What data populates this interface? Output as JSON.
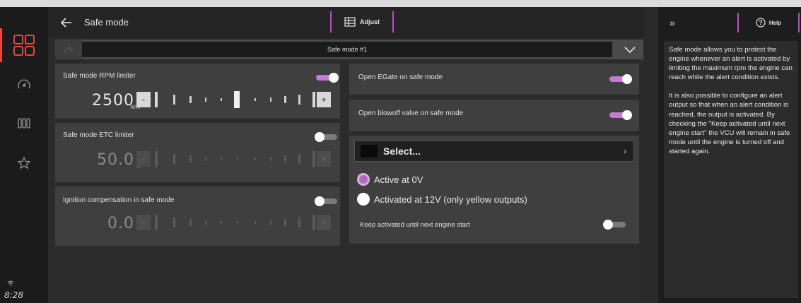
{
  "nav": {
    "time": "8:28",
    "items": [
      {
        "name": "dashboard-grid-icon",
        "active": true
      },
      {
        "name": "gauge-icon",
        "active": false
      },
      {
        "name": "gauges-bars-icon",
        "active": false
      },
      {
        "name": "star-icon",
        "active": false
      }
    ]
  },
  "header": {
    "title": "Safe mode",
    "adjust_label": "Adjust",
    "icons": [
      "block-icon",
      "undo-icon",
      "redo-icon",
      "save-icon"
    ]
  },
  "subbar": {
    "selected": "Safe mode #1"
  },
  "cards": {
    "rpm": {
      "label": "Safe mode RPM limiter",
      "value": "2500",
      "unit": "RPM",
      "enabled": true,
      "minus": "-",
      "plus": "+"
    },
    "etc": {
      "label": "Safe mode ETC limiter",
      "value": "50.0",
      "unit": "%",
      "enabled": false,
      "minus": "-",
      "plus": "+"
    },
    "ign": {
      "label": "Ignition compensation in safe mode",
      "value": "0.0",
      "unit": "°",
      "enabled": false,
      "minus": "-",
      "plus": "+"
    },
    "egate": {
      "label": "Open EGate on safe mode",
      "enabled": true
    },
    "blowoff": {
      "label": "Open blowoff valve on safe mode",
      "enabled": true
    },
    "output": {
      "select_label": "Select...",
      "radio_active0v": "Active at 0V",
      "radio_active12v": "Activated at 12V (only yellow outputs)",
      "selected_radio": "Active at 0V",
      "keep_label": "Keep activated until next engine start",
      "keep_enabled": false
    }
  },
  "help": {
    "label": "Help",
    "p1": "Safe mode allows you to protect the engine whenever an alert is activated by limiting the maximum rpm the engine can reach while the alert condition exists.",
    "p2": "It is also possible to configure an alert output so that when an alert condition is reached, the output is activated. By checking the \"Keep activated until next engine start\" the VCU will remain in safe mode until the engine is turned off and started again."
  },
  "colors": {
    "accent": "#c04bc6",
    "toggle_on": "#c07cd0",
    "active_nav": "#e8453c"
  }
}
